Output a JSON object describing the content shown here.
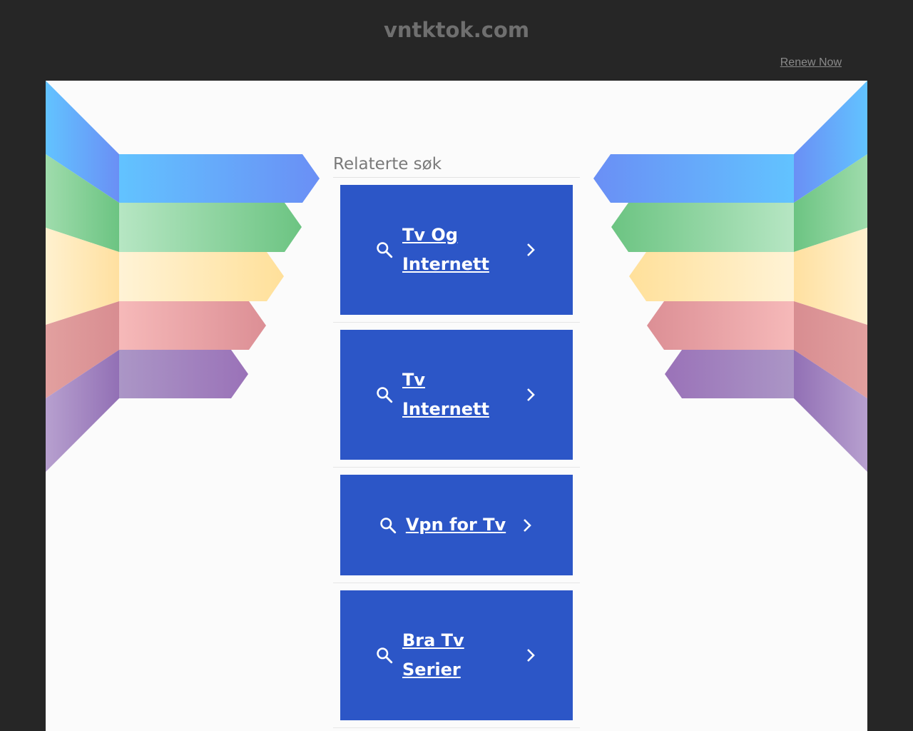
{
  "header": {
    "domain": "vntktok.com",
    "renew_label": "Renew Now"
  },
  "main": {
    "section_title": "Relaterte søk",
    "results": [
      {
        "label": "Tv Og Internett"
      },
      {
        "label": "Tv Internett"
      },
      {
        "label": "Vpn for Tv"
      },
      {
        "label": "Bra Tv Serier"
      }
    ]
  },
  "colors": {
    "background": "#262626",
    "content_bg": "#fbfbfb",
    "card_blue": "#2c56c7",
    "ribbon_blue": "#5ab0f5",
    "ribbon_green": "#72c98a",
    "ribbon_yellow": "#ffe5a6",
    "ribbon_pink": "#e59b9b",
    "ribbon_purple": "#a47fc0"
  },
  "icons": {
    "result_leading": "search-icon",
    "result_trailing": "chevron-right-icon"
  }
}
